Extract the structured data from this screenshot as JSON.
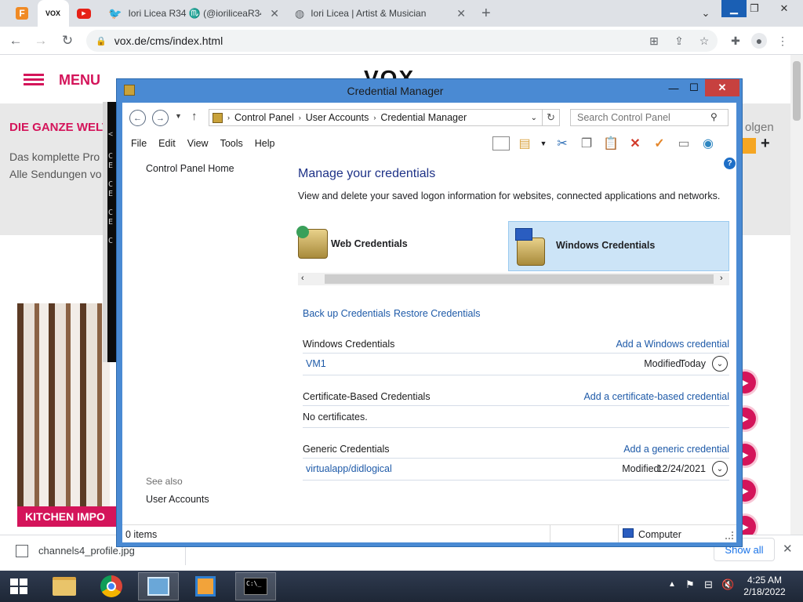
{
  "browser": {
    "tabs": [
      {
        "label": "",
        "icon": "firefox-favicon"
      },
      {
        "label": "VOX",
        "icon": "vox-favicon"
      },
      {
        "label": "",
        "icon": "youtube-favicon"
      },
      {
        "label": "Iori Licea R34 ♏ (@ioriliceaR34)",
        "icon": "twitter-favicon"
      },
      {
        "label": "Iori Licea | Artist & Musician",
        "icon": "globe-favicon"
      }
    ],
    "url": "vox.de/cms/index.html",
    "new_tab_symbol": "+"
  },
  "webpage": {
    "menu_label": "MENU",
    "logo": "VOX",
    "headline": "DIE GANZE WELT",
    "subline1": "Das komplette Pro",
    "subline2": "Alle Sendungen vo",
    "folgen": "olgen",
    "promo_label": "KITCHEN IMPO"
  },
  "download": {
    "filename": "channels4_profile.jpg",
    "show_all": "Show all"
  },
  "cmd_window": {
    "chars": [
      "<",
      "C",
      "E",
      "C",
      "E",
      "C",
      "E",
      "C"
    ]
  },
  "cm": {
    "title": "Credential Manager",
    "breadcrumb": [
      "Control Panel",
      "User Accounts",
      "Credential Manager"
    ],
    "search_placeholder": "Search Control Panel",
    "menu": [
      "File",
      "Edit",
      "View",
      "Tools",
      "Help"
    ],
    "left": {
      "home": "Control Panel Home",
      "see_also": "See also",
      "user_accounts": "User Accounts"
    },
    "main": {
      "heading": "Manage your credentials",
      "description": "View and delete your saved logon information for websites, connected applications and networks.",
      "web_tab": "Web Credentials",
      "windows_tab": "Windows Credentials",
      "backup": "Back up Credentials",
      "restore": "Restore Credentials",
      "windows_section": {
        "title": "Windows Credentials",
        "add": "Add a Windows credential",
        "items": [
          {
            "name": "VM1",
            "modified_label": "Modified:",
            "modified": "Today"
          }
        ]
      },
      "cert_section": {
        "title": "Certificate-Based Credentials",
        "add": "Add a certificate-based credential",
        "empty": "No certificates."
      },
      "generic_section": {
        "title": "Generic Credentials",
        "add": "Add a generic credential",
        "items": [
          {
            "name": "virtualapp/didlogical",
            "modified_label": "Modified:",
            "modified": "12/24/2021"
          }
        ]
      }
    },
    "status": {
      "items": "0 items",
      "computer": "Computer"
    }
  },
  "taskbar": {
    "time": "4:25 AM",
    "date": "2/18/2022"
  },
  "colors": {
    "vox_accent": "#d4145a",
    "link": "#1e5aa8",
    "window_frame": "#4a8ad3",
    "close_red": "#c7413f"
  }
}
